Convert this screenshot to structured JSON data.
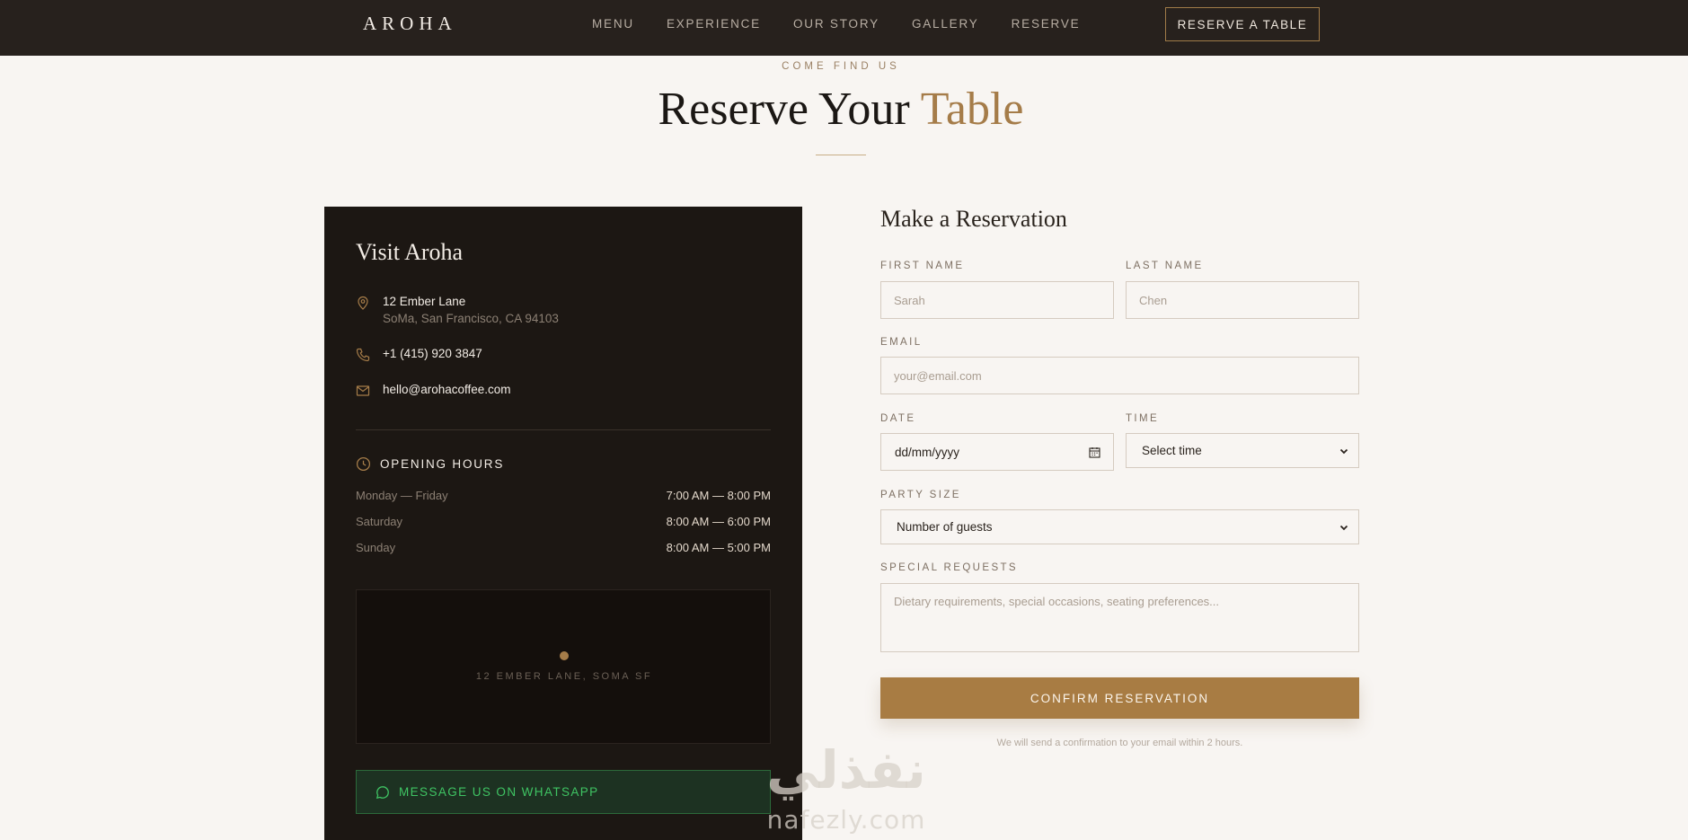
{
  "nav": {
    "brand": "AROHA",
    "links": [
      "MENU",
      "EXPERIENCE",
      "OUR STORY",
      "GALLERY",
      "RESERVE"
    ],
    "cta": "RESERVE A TABLE"
  },
  "hero": {
    "eyebrow": "COME FIND US",
    "title_main": "Reserve Your",
    "title_accent": "Table"
  },
  "info": {
    "title": "Visit Aroha",
    "address_line1": "12 Ember Lane",
    "address_line2": "SoMa, San Francisco, CA 94103",
    "phone": "+1 (415) 920 3847",
    "email": "hello@arohacoffee.com",
    "hours_title": "OPENING HOURS",
    "hours": [
      {
        "day": "Monday — Friday",
        "time": "7:00 AM — 8:00 PM"
      },
      {
        "day": "Saturday",
        "time": "8:00 AM — 6:00 PM"
      },
      {
        "day": "Sunday",
        "time": "8:00 AM — 5:00 PM"
      }
    ],
    "map_label": "12 EMBER LANE, SOMA SF",
    "whatsapp": "MESSAGE US ON WHATSAPP"
  },
  "form": {
    "title": "Make a Reservation",
    "first_name": {
      "label": "FIRST NAME",
      "placeholder": "Sarah"
    },
    "last_name": {
      "label": "LAST NAME",
      "placeholder": "Chen"
    },
    "email": {
      "label": "EMAIL",
      "placeholder": "your@email.com"
    },
    "date": {
      "label": "DATE",
      "value": "dd/mm/yyyy"
    },
    "time": {
      "label": "TIME",
      "value": "Select time"
    },
    "party": {
      "label": "PARTY SIZE",
      "value": "Number of guests"
    },
    "requests": {
      "label": "SPECIAL REQUESTS",
      "placeholder": "Dietary requirements, special occasions, seating preferences..."
    },
    "submit": "CONFIRM RESERVATION",
    "note": "We will send a confirmation to your email within 2 hours."
  },
  "watermark": {
    "arabic": "نفذلي",
    "latin": "nafezly.com"
  },
  "colors": {
    "nav_bg": "#27211d",
    "page_bg": "#f8f5f2",
    "accent": "#a57c49",
    "card_bg": "#1c1713",
    "whatsapp_green": "#3fc463"
  },
  "icons": {
    "address": "map-pin-icon",
    "phone": "phone-icon",
    "email": "mail-icon",
    "hours": "clock-icon",
    "date": "calendar-icon",
    "select": "chevron-down-icon",
    "whatsapp": "chat-bubble-icon"
  }
}
